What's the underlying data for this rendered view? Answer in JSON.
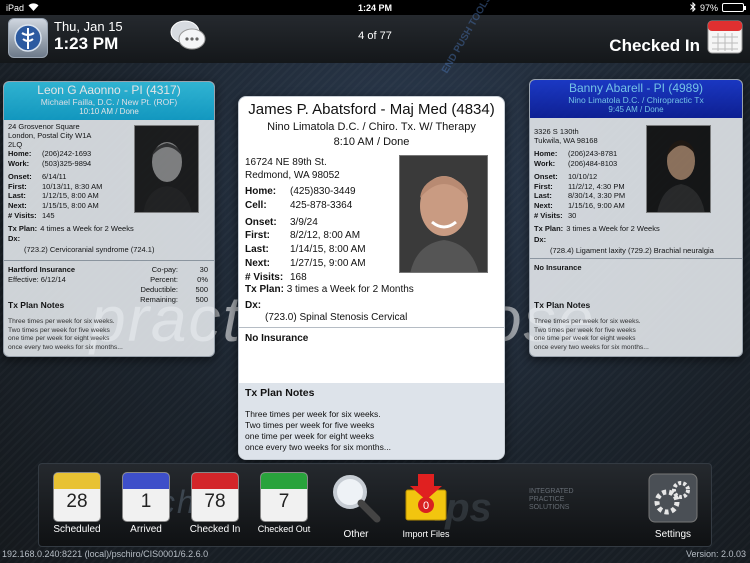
{
  "status_bar": {
    "carrier": "iPad",
    "time": "1:24 PM",
    "battery": "97%",
    "battery_level": 0.97
  },
  "header": {
    "date": "Thu, Jan 15",
    "time": "1:23 PM",
    "counter": "4 of 77",
    "view_label": "Checked In"
  },
  "background": {
    "word": "practice purpose"
  },
  "cards": {
    "left": {
      "name": "Leon G Aaonno - PI (4317)",
      "provider": "Michael Failla, D.C. / New Pt. (ROF)",
      "time": "10:10 AM / Done",
      "address": [
        "24 Grosvenor Square",
        "London, Postal City  W1A",
        "2LQ"
      ],
      "rows": [
        {
          "label": "Home:",
          "value": "(206)242-1693"
        },
        {
          "label": "Work:",
          "value": "(503)325-9894"
        },
        {
          "label": "Onset:",
          "value": "6/14/11"
        },
        {
          "label": "First:",
          "value": "10/13/11, 8:30 AM"
        },
        {
          "label": "Last:",
          "value": "1/12/15, 8:00 AM"
        },
        {
          "label": "Next:",
          "value": "1/15/15, 8:00 AM"
        },
        {
          "label": "# Visits:",
          "value": "145"
        }
      ],
      "tx_label": "Tx Plan:",
      "tx_plan": "4 times a Week for 2 Weeks",
      "dx_label": "Dx:",
      "dx": "(723.2) Cervicoranial syndrome (724.1)",
      "insurance": "Hartford Insurance",
      "effective": "Effective: 6/12/14",
      "ins_rows": [
        {
          "label": "Co-pay:",
          "value": "30"
        },
        {
          "label": "Percent:",
          "value": "0%"
        },
        {
          "label": "Deductible:",
          "value": "500"
        },
        {
          "label": "Remaining:",
          "value": "500"
        }
      ],
      "notes_title": "Tx Plan Notes",
      "notes": [
        "Three times per week for six weeks.",
        "Two times per week for five weeks",
        "one time per week for eight weeks",
        "once every two weeks for six months..."
      ]
    },
    "main": {
      "name": "James P. Abatsford - Maj Med (4834)",
      "provider": "Nino Limatola D.C. / Chiro. Tx. W/ Therapy",
      "time": "8:10 AM / Done",
      "address": [
        "16724 NE 89th St.",
        "Redmond, WA  98052"
      ],
      "rows": [
        {
          "label": "Home:",
          "value": "(425)830-3449"
        },
        {
          "label": "Cell:",
          "value": "425-878-3364"
        },
        {
          "label": "Onset:",
          "value": "3/9/24"
        },
        {
          "label": "First:",
          "value": "8/2/12, 8:00 AM"
        },
        {
          "label": "Last:",
          "value": "1/14/15, 8:00 AM"
        },
        {
          "label": "Next:",
          "value": "1/27/15, 9:00 AM"
        },
        {
          "label": "# Visits:",
          "value": "168"
        }
      ],
      "tx_label": "Tx Plan:",
      "tx_plan": "3 times a Week for 2 Months",
      "dx_label": "Dx:",
      "dx": "(723.0) Spinal Stenosis Cervical",
      "insurance": "No Insurance",
      "notes_title": "Tx Plan Notes",
      "notes": [
        "Three times per week for six weeks.",
        "Two times per week for five weeks",
        "one time per week for eight weeks",
        "once every two weeks for six months..."
      ]
    },
    "right": {
      "name": "Banny Abarell - PI (4989)",
      "provider": "Nino Limatola D.C. / Chiropractic Tx",
      "time": "9:45 AM / Done",
      "address": [
        "3326 S 130th",
        "Tukwila, WA  98168"
      ],
      "rows": [
        {
          "label": "Home:",
          "value": "(206)243-8781"
        },
        {
          "label": "Work:",
          "value": "(206)484-8103"
        },
        {
          "label": "Onset:",
          "value": "10/10/12"
        },
        {
          "label": "First:",
          "value": "11/2/12, 4:30 PM"
        },
        {
          "label": "Last:",
          "value": "8/30/14, 3:30 PM"
        },
        {
          "label": "Next:",
          "value": "1/15/16, 9:00 AM"
        },
        {
          "label": "# Visits:",
          "value": "30"
        }
      ],
      "tx_label": "Tx Plan:",
      "tx_plan": "3 times a Week for 2 Weeks",
      "dx_label": "Dx:",
      "dx": "(728.4) Ligament laxity (729.2) Brachial neuralgia",
      "insurance": "No Insurance",
      "notes_title": "Tx Plan Notes",
      "notes": [
        "Three times per week for six weeks.",
        "Two times per week for five weeks",
        "one time per week for eight weeks",
        "once every two weeks for six months..."
      ]
    }
  },
  "dock": {
    "scheduled": {
      "count": "28",
      "label": "Scheduled",
      "color": "#e8c233"
    },
    "arrived": {
      "count": "1",
      "label": "Arrived",
      "color": "#3e4fc9"
    },
    "checked_in": {
      "count": "78",
      "label": "Checked In",
      "color": "#d3262a"
    },
    "checked_out": {
      "count": "7",
      "label": "Checked Out",
      "color": "#29a33c"
    },
    "other_label": "Other",
    "import_count": "0",
    "import_label": "Import Files",
    "settings_label": "Settings",
    "watermark": "chiro",
    "watermark_sub": "ace                nt softw",
    "brand": "ips",
    "brand_tagline": [
      "INTEGRATED",
      "PRACTICE",
      "SOLUTIONS"
    ]
  },
  "footer": {
    "path": "192.168.0.240:8221 (local)/pschiro/CIS0001/6.2.6.0",
    "version": "Version: 2.0.03"
  }
}
